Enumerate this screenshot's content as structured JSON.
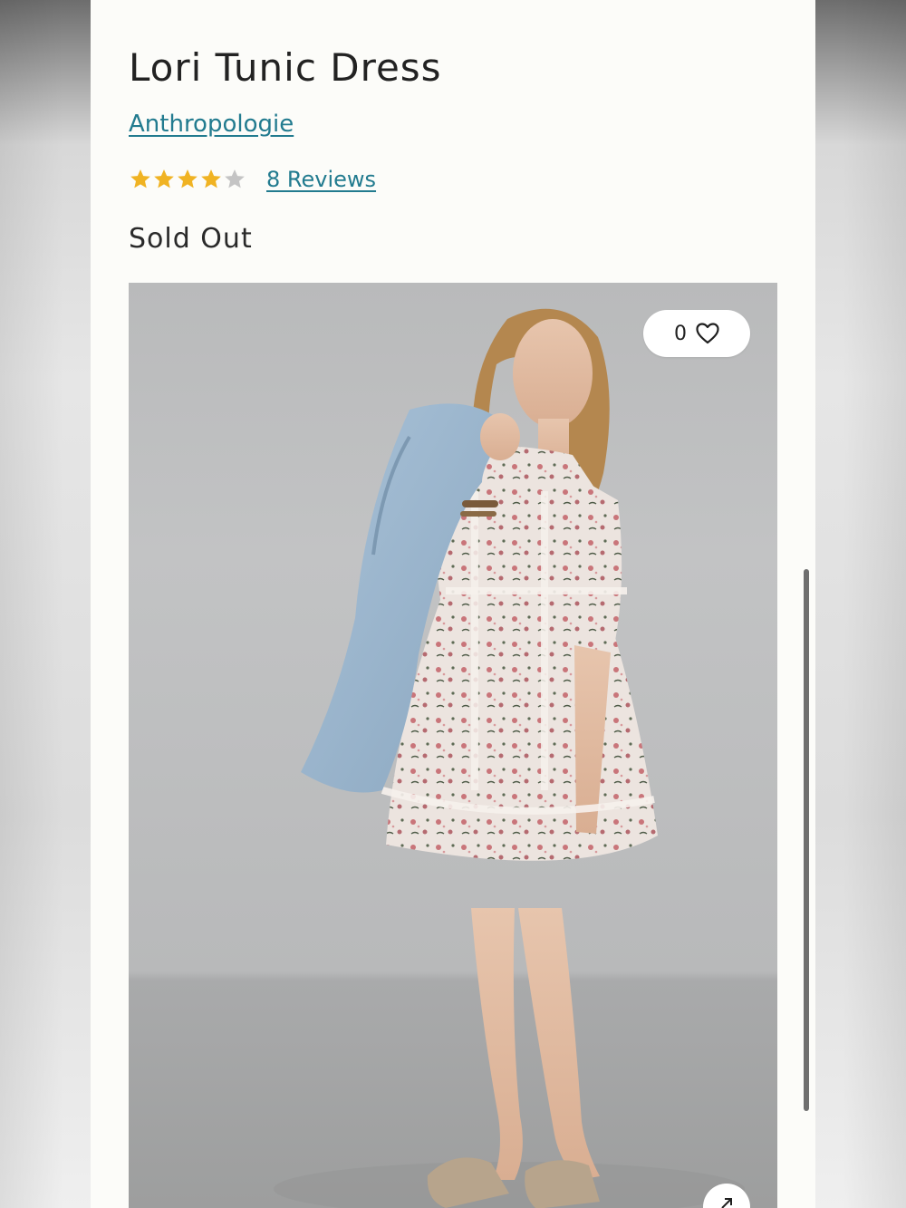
{
  "product": {
    "title": "Lori Tunic Dress",
    "brand": "Anthropologie",
    "rating": {
      "stars": 4,
      "max_stars": 5,
      "reviews_label": "8 Reviews"
    },
    "status": "Sold Out"
  },
  "gallery": {
    "like_count": "0",
    "icons": {
      "like": "heart-icon",
      "expand": "arrow-up-right-icon"
    }
  },
  "colors": {
    "link": "#227b8f",
    "star_filled": "#f0b323",
    "star_empty": "#c4c4c4"
  }
}
